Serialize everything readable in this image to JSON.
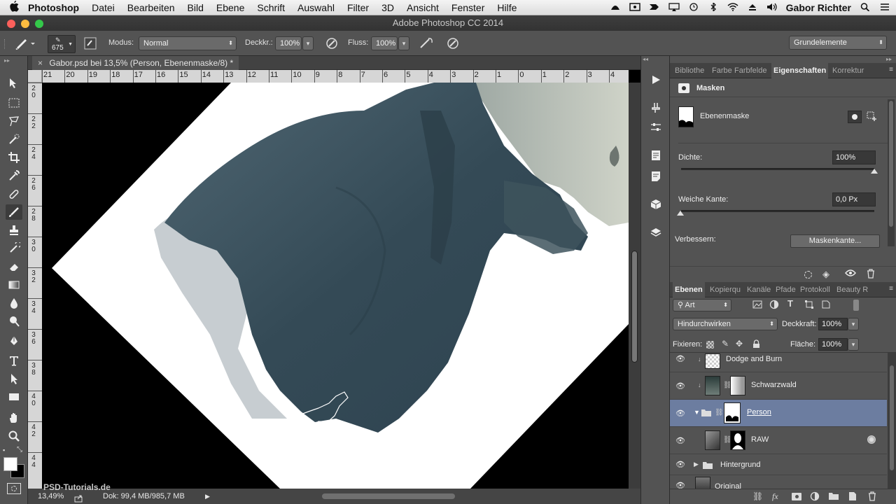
{
  "menubar": {
    "app_name": "Photoshop",
    "items": [
      "Datei",
      "Bearbeiten",
      "Bild",
      "Ebene",
      "Schrift",
      "Auswahl",
      "Filter",
      "3D",
      "Ansicht",
      "Fenster",
      "Hilfe"
    ],
    "user": "Gabor Richter"
  },
  "window": {
    "title": "Adobe Photoshop CC 2014"
  },
  "options": {
    "brush_size": "675",
    "mode_label": "Modus:",
    "mode_value": "Normal",
    "opacity_label": "Deckkr.:",
    "opacity_value": "100%",
    "flow_label": "Fluss:",
    "flow_value": "100%",
    "workspace": "Grundelemente"
  },
  "document": {
    "tab_title": "Gabor.psd bei 13,5% (Person, Ebenenmaske/8) *",
    "ruler_h": [
      "21",
      "20",
      "19",
      "18",
      "17",
      "16",
      "15",
      "14",
      "13",
      "12",
      "11",
      "10",
      "9",
      "8",
      "7",
      "6",
      "5",
      "4",
      "3",
      "2",
      "1",
      "0",
      "1",
      "2",
      "3",
      "4"
    ],
    "ruler_v": [
      "2 0",
      "2 2",
      "2 4",
      "2 6",
      "2 8",
      "3 0",
      "3 2",
      "3 4",
      "3 6",
      "3 8",
      "4 0",
      "4 2",
      "4 4"
    ]
  },
  "status": {
    "zoom": "13,49%",
    "doc_size": "Dok: 99,4 MB/985,7 MB",
    "watermark": "PSD-Tutorials.de"
  },
  "properties_panel": {
    "tabs": [
      "Bibliothe",
      "Farbe",
      "Farbfelde",
      "Eigenschaften",
      "Korrektur"
    ],
    "header": "Masken",
    "mask_label": "Ebenenmaske",
    "density_label": "Dichte:",
    "density_value": "100%",
    "feather_label": "Weiche Kante:",
    "feather_value": "0,0 Px",
    "refine_label": "Verbessern:",
    "refine_button": "Maskenkante..."
  },
  "layers_panel": {
    "tabs": [
      "Ebenen",
      "Kopierqu",
      "Kanäle",
      "Pfade",
      "Protokoll",
      "Beauty R"
    ],
    "filter_kind": "Art",
    "blend_mode": "Hindurchwirken",
    "opacity_label": "Deckkraft:",
    "opacity_value": "100%",
    "lock_label": "Fixieren:",
    "fill_label": "Fläche:",
    "fill_value": "100%",
    "layers": [
      {
        "name": "Dodge and Burn"
      },
      {
        "name": "Schwarzwald"
      },
      {
        "name": "Person"
      },
      {
        "name": "RAW"
      },
      {
        "name": "Hintergrund"
      },
      {
        "name": "Original"
      }
    ]
  }
}
